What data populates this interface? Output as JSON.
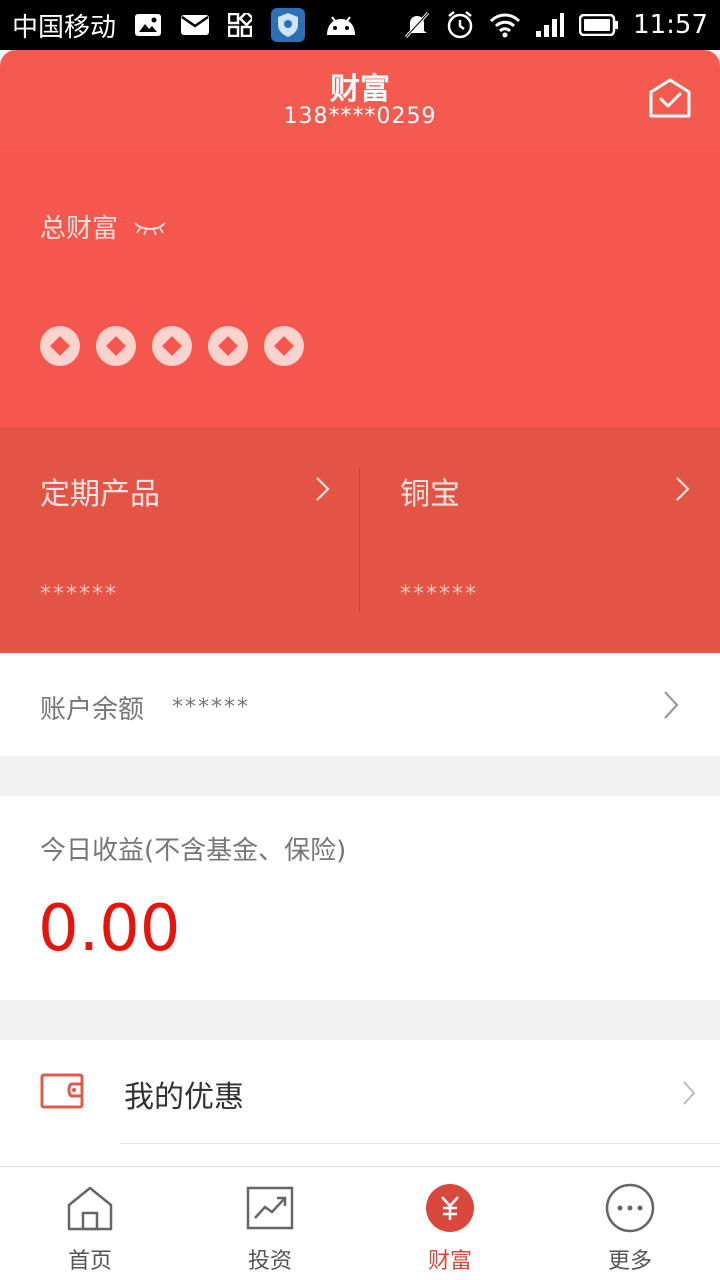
{
  "status_bar": {
    "carrier": "中国移动",
    "time": "11:57"
  },
  "header": {
    "title": "财富",
    "phone": "138****0259"
  },
  "total_wealth": {
    "label": "总财富",
    "masked_glyphs": 5
  },
  "products": [
    {
      "name": "定期产品",
      "value": "******"
    },
    {
      "name": "铜宝",
      "value": "******"
    }
  ],
  "balance": {
    "label": "账户余额",
    "value": "******"
  },
  "today_earnings": {
    "label": "今日收益(不含基金、保险)",
    "value": "0.00"
  },
  "menu": [
    {
      "label": "我的优惠",
      "icon": "wallet-icon"
    }
  ],
  "tabs": [
    {
      "label": "首页",
      "icon": "home-icon"
    },
    {
      "label": "投资",
      "icon": "chart-icon"
    },
    {
      "label": "财富",
      "icon": "yuan-icon",
      "active": true
    },
    {
      "label": "更多",
      "icon": "more-icon"
    }
  ],
  "colors": {
    "brand": "#f55a4e",
    "accent_dark": "#e45445",
    "earnings_text": "#e8140b"
  }
}
